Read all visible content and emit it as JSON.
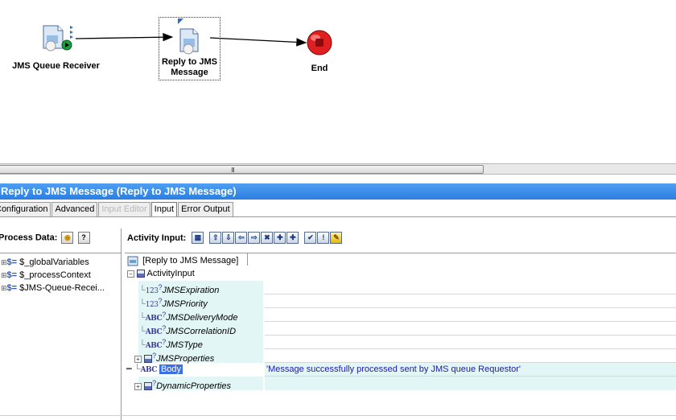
{
  "canvas": {
    "nodes": {
      "receiver": {
        "label": "JMS Queue Receiver"
      },
      "reply": {
        "label_line1": "Reply to JMS",
        "label_line2": "Message"
      },
      "end": {
        "label": "End"
      }
    },
    "scroll_grip": "III"
  },
  "titlebar": {
    "text": "Reply to JMS Message (Reply to JMS Message)"
  },
  "tabs": [
    {
      "label": "Configuration"
    },
    {
      "label": "Advanced"
    },
    {
      "label": "Input Editor"
    },
    {
      "label": "Input"
    },
    {
      "label": "Error Output"
    }
  ],
  "process_data": {
    "header": "Process Data:",
    "items": [
      {
        "label": "$_globalVariables"
      },
      {
        "label": "$_processContext"
      },
      {
        "label": "$JMS-Queue-Recei..."
      }
    ]
  },
  "activity_input": {
    "header": "Activity Input:",
    "root_label": "[Reply to JMS Message]",
    "activity_input_label": "ActivityInput",
    "fields": [
      {
        "name": "JMSExpiration",
        "type": "123",
        "value": ""
      },
      {
        "name": "JMSPriority",
        "type": "123",
        "value": ""
      },
      {
        "name": "JMSDeliveryMode",
        "type": "ABC",
        "value": ""
      },
      {
        "name": "JMSCorrelationID",
        "type": "ABC",
        "value": ""
      },
      {
        "name": "JMSType",
        "type": "ABC",
        "value": ""
      },
      {
        "name": "JMSProperties",
        "type": "complex",
        "value": ""
      },
      {
        "name": "Body",
        "type": "ABC",
        "value": "'Message successfully processed sent by JMS queue Requestor'"
      },
      {
        "name": "DynamicProperties",
        "type": "complex",
        "value": ""
      }
    ]
  },
  "colors": {
    "titlebar": "#2b7fe0",
    "selection": "#3a6fe6",
    "end_node": "#e02020",
    "value_text": "#1a1aa8"
  }
}
